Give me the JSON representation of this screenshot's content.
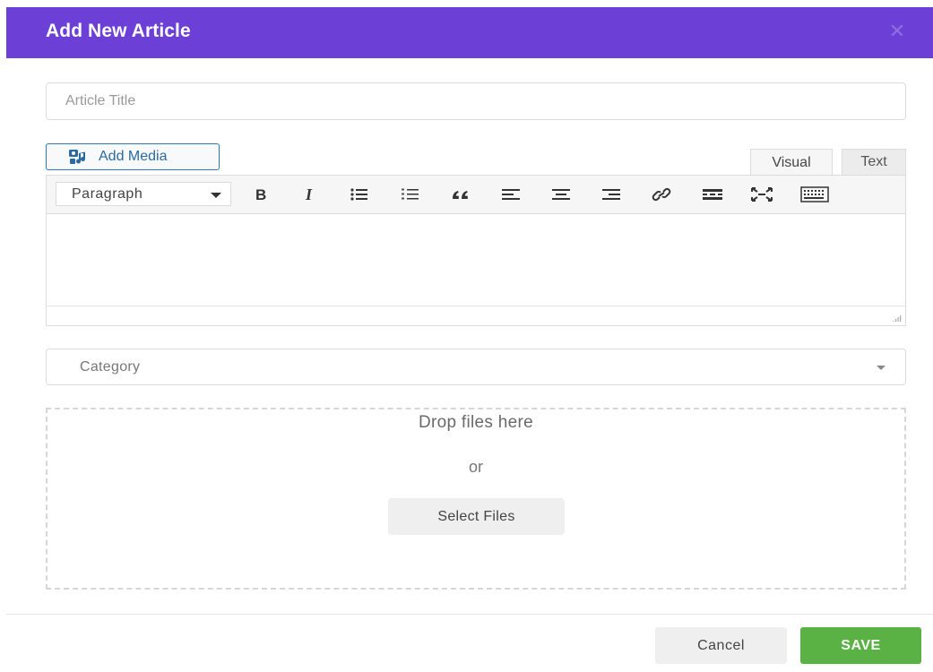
{
  "dialog": {
    "title": "Add New Article",
    "close_icon": "close-icon"
  },
  "form": {
    "title_placeholder": "Article Title",
    "title_value": "",
    "add_media_label": "Add Media",
    "add_media_icon": "media-icon"
  },
  "editor": {
    "tabs": [
      {
        "label": "Visual",
        "active": true
      },
      {
        "label": "Text",
        "active": false
      }
    ],
    "format_select": "Paragraph",
    "toolbar_icons": [
      "bold-icon",
      "italic-icon",
      "bullet-list-icon",
      "numbered-list-icon",
      "blockquote-icon",
      "align-left-icon",
      "align-center-icon",
      "align-right-icon",
      "link-icon",
      "read-more-icon",
      "fullscreen-icon",
      "toolbar-toggle-icon"
    ],
    "content": ""
  },
  "category": {
    "placeholder": "Category"
  },
  "upload": {
    "drop_text": "Drop files here",
    "or_text": "or",
    "select_button": "Select Files"
  },
  "footer": {
    "cancel_label": "Cancel",
    "save_label": "SAVE"
  },
  "colors": {
    "header_bg": "#6c40d6",
    "save_bg": "#59b243",
    "media_border": "#2f78b5"
  }
}
